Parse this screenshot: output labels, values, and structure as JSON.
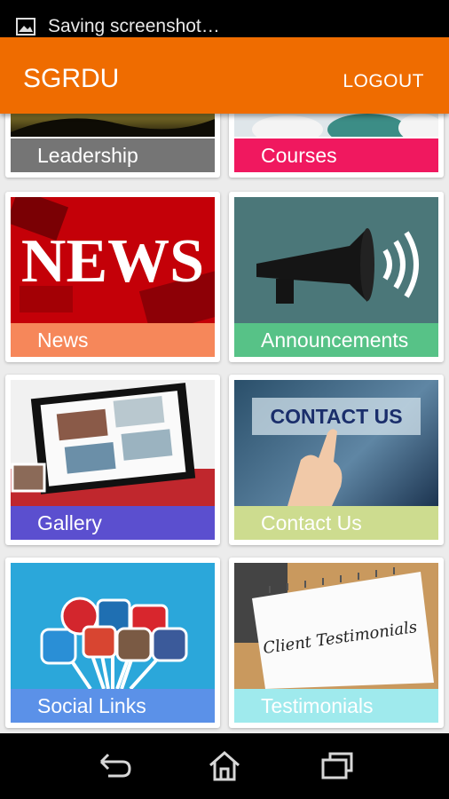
{
  "status_bar": {
    "notification": "Saving screenshot…"
  },
  "app_bar": {
    "title": "SGRDU",
    "logout_label": "LOGOUT"
  },
  "tiles": [
    {
      "label": "Leadership",
      "color": "#757575"
    },
    {
      "label": "Courses",
      "color": "#f0185f"
    },
    {
      "label": "News",
      "color": "#f6875a",
      "art_text": "NEWS"
    },
    {
      "label": "Announcements",
      "color": "#57c287"
    },
    {
      "label": "Gallery",
      "color": "#5b4fcf"
    },
    {
      "label": "Contact Us",
      "color": "#cddc8f",
      "art_text": "CONTACT US"
    },
    {
      "label": "Social Links",
      "color": "#5b91e8"
    },
    {
      "label": "Testimonials",
      "color": "#9feaed",
      "art_text": "Client Testimonials"
    }
  ],
  "nav_bar": {
    "icons": [
      "back-icon",
      "home-icon",
      "recents-icon"
    ]
  },
  "colors": {
    "accent": "#ef6c00"
  }
}
